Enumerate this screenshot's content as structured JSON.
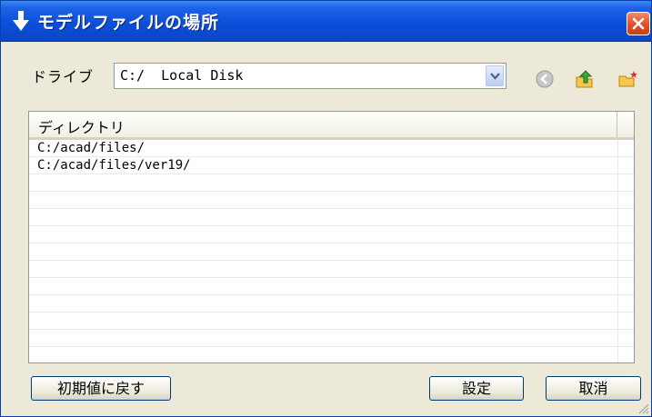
{
  "window": {
    "title": "モデルファイルの場所",
    "title_icon": "down-arrow-icon",
    "close_icon": "close-icon",
    "accent": "#0a4ed8",
    "close_color": "#e2532c"
  },
  "drive": {
    "label": "ドライブ",
    "selected": "C:/  Local Disk",
    "dropdown_icon": "chevron-down-icon"
  },
  "toolbar": {
    "back_icon": "back-icon",
    "up_icon": "up-folder-icon",
    "new_folder_icon": "new-folder-icon"
  },
  "directories": {
    "column_header": "ディレクトリ",
    "rows": [
      "C:/acad/files/",
      "C:/acad/files/ver19/"
    ]
  },
  "buttons": {
    "reset_label": "初期値に戻す",
    "ok_label": "設定",
    "cancel_label": "取消"
  }
}
